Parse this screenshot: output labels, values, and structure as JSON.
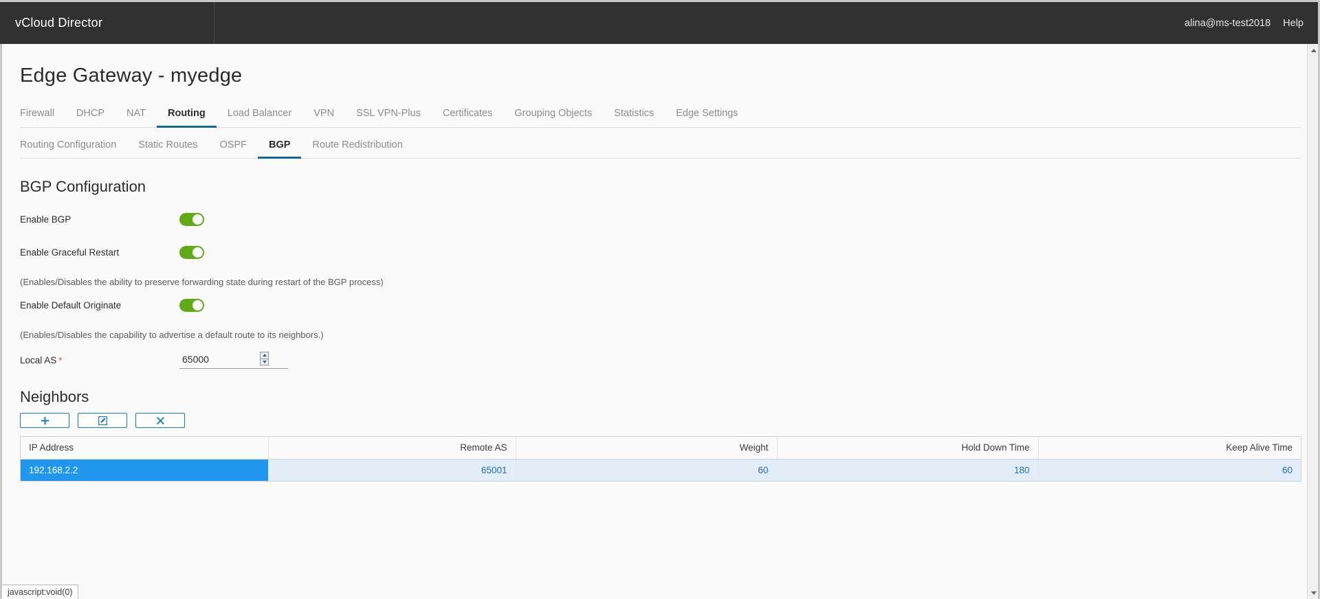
{
  "header": {
    "brand": "vCloud Director",
    "user": "alina@ms-test2018",
    "help": "Help"
  },
  "page": {
    "title": "Edge Gateway - myedge"
  },
  "tabs_primary": [
    {
      "label": "Firewall",
      "active": false
    },
    {
      "label": "DHCP",
      "active": false
    },
    {
      "label": "NAT",
      "active": false
    },
    {
      "label": "Routing",
      "active": true
    },
    {
      "label": "Load Balancer",
      "active": false
    },
    {
      "label": "VPN",
      "active": false
    },
    {
      "label": "SSL VPN-Plus",
      "active": false
    },
    {
      "label": "Certificates",
      "active": false
    },
    {
      "label": "Grouping Objects",
      "active": false
    },
    {
      "label": "Statistics",
      "active": false
    },
    {
      "label": "Edge Settings",
      "active": false
    }
  ],
  "tabs_secondary": [
    {
      "label": "Routing Configuration",
      "active": false
    },
    {
      "label": "Static Routes",
      "active": false
    },
    {
      "label": "OSPF",
      "active": false
    },
    {
      "label": "BGP",
      "active": true
    },
    {
      "label": "Route Redistribution",
      "active": false
    }
  ],
  "bgp_config": {
    "section_title": "BGP Configuration",
    "enable_bgp_label": "Enable BGP",
    "enable_bgp_value": "on",
    "enable_graceful_restart_label": "Enable Graceful Restart",
    "enable_graceful_restart_value": "on",
    "graceful_restart_help": "(Enables/Disables the ability to preserve forwarding state during restart of the BGP process)",
    "enable_default_originate_label": "Enable Default Originate",
    "enable_default_originate_value": "on",
    "default_originate_help": "(Enables/Disables the capability to advertise a default route to its neighbors.)",
    "local_as_label": "Local AS",
    "local_as_required": "*",
    "local_as_value": "65000"
  },
  "neighbors": {
    "section_title": "Neighbors",
    "buttons": [
      {
        "name": "add-neighbor-button",
        "icon": "plus-icon",
        "label": ""
      },
      {
        "name": "edit-neighbor-button",
        "icon": "edit-pencil-icon",
        "label": ""
      },
      {
        "name": "delete-neighbor-button",
        "icon": "close-x-icon",
        "label": ""
      }
    ],
    "columns": [
      "IP Address",
      "Remote AS",
      "Weight",
      "Hold Down Time",
      "Keep Alive Time"
    ],
    "rows": [
      {
        "ip_address": "192.168.2.2",
        "remote_as": "65001",
        "weight": "60",
        "hold_down_time": "180",
        "keep_alive_time": "60",
        "selected": true
      }
    ]
  },
  "status_bar": {
    "text": "javascript:void(0)"
  },
  "colors": {
    "header_bg": "#313131",
    "toggle_on": "#60a917",
    "accent_blue": "#0f7dc2",
    "tab_active_underline": "#0f6a9e",
    "row_selected": "#2196ef",
    "row_selected_light": "#e2edf7",
    "required_star": "#e03b24"
  }
}
